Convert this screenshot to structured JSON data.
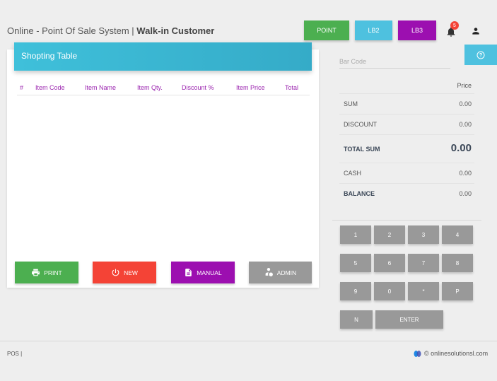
{
  "header": {
    "title_prefix": "Online - Point Of Sale System | ",
    "title_customer": "Walk-in Customer",
    "buttons": {
      "point": "POINT",
      "lb2": "LB2",
      "lb3": "LB3"
    },
    "notification_count": "5"
  },
  "shopping_table": {
    "title": "Shopting Table",
    "columns": [
      "#",
      "Item Code",
      "Item Name",
      "Item Qty.",
      "Discount %",
      "Item Price",
      "Total"
    ],
    "rows": []
  },
  "actions": {
    "print": "PRINT",
    "new": "NEW",
    "manual": "MANUAL",
    "admin": "ADMIN"
  },
  "barcode": {
    "placeholder": "Bar Code",
    "value": ""
  },
  "summary": {
    "price_header": "Price",
    "rows": [
      {
        "label": "SUM",
        "value": "0.00"
      },
      {
        "label": "DISCOUNT",
        "value": "0.00"
      },
      {
        "label": "TOTAL SUM",
        "value": "0.00"
      },
      {
        "label": "CASH",
        "value": "0.00"
      },
      {
        "label": "BALANCE",
        "value": "0.00"
      }
    ]
  },
  "keypad": {
    "row1": [
      "1",
      "2",
      "3",
      "4"
    ],
    "row2": [
      "5",
      "6",
      "7",
      "8"
    ],
    "row3": [
      "9",
      "0",
      "*",
      "P"
    ],
    "row4": [
      "N",
      "ENTER"
    ]
  },
  "footer": {
    "left": "POS |",
    "right": "© onlinesolutionsl.com"
  },
  "colors": {
    "green": "#4caf50",
    "cyan": "#4ec1df",
    "purple": "#9c0fb0",
    "red": "#f44336",
    "gray": "#999999"
  },
  "icons": {
    "notifications": "bell-icon",
    "account": "person-icon",
    "help": "help-circle-icon",
    "print": "printer-icon",
    "new": "power-icon",
    "manual": "document-icon",
    "admin": "admin-icon"
  }
}
